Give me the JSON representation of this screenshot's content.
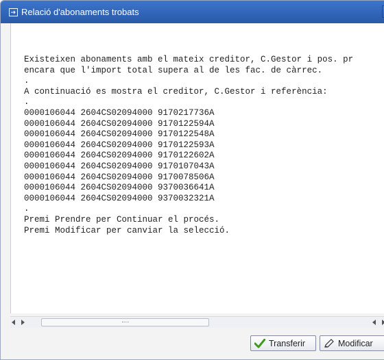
{
  "window": {
    "title": "Relació d'abonaments trobats",
    "close_glyph": "X"
  },
  "message": {
    "lines": [
      "Existeixen abonaments amb el mateix creditor, C.Gestor i pos. pr",
      "encara que l'import total supera al de les fac. de càrrec.",
      ".",
      "A continuació es mostra el creditor, C.Gestor i referència:",
      ".",
      "0000106044 2604CS02094000 9170217736A",
      "0000106044 2604CS02094000 9170122594A",
      "0000106044 2604CS02094000 9170122548A",
      "0000106044 2604CS02094000 9170122593A",
      "0000106044 2604CS02094000 9170122602A",
      "0000106044 2604CS02094000 9170107043A",
      "0000106044 2604CS02094000 9170078506A",
      "0000106044 2604CS02094000 9370036641A",
      "0000106044 2604CS02094000 9370032321A",
      ".",
      "Premi Prendre per Continuar el procés.",
      "Premi Modificar per canviar la selecció."
    ]
  },
  "buttons": {
    "transfer_label": "Transferir",
    "modify_label": "Modificar"
  },
  "icons": {
    "title": "dialog-icon",
    "transfer": "checkmark-icon",
    "modify": "pencil-icon"
  },
  "colors": {
    "titlebar": "#2f64b7",
    "check": "#3c9a1f"
  }
}
